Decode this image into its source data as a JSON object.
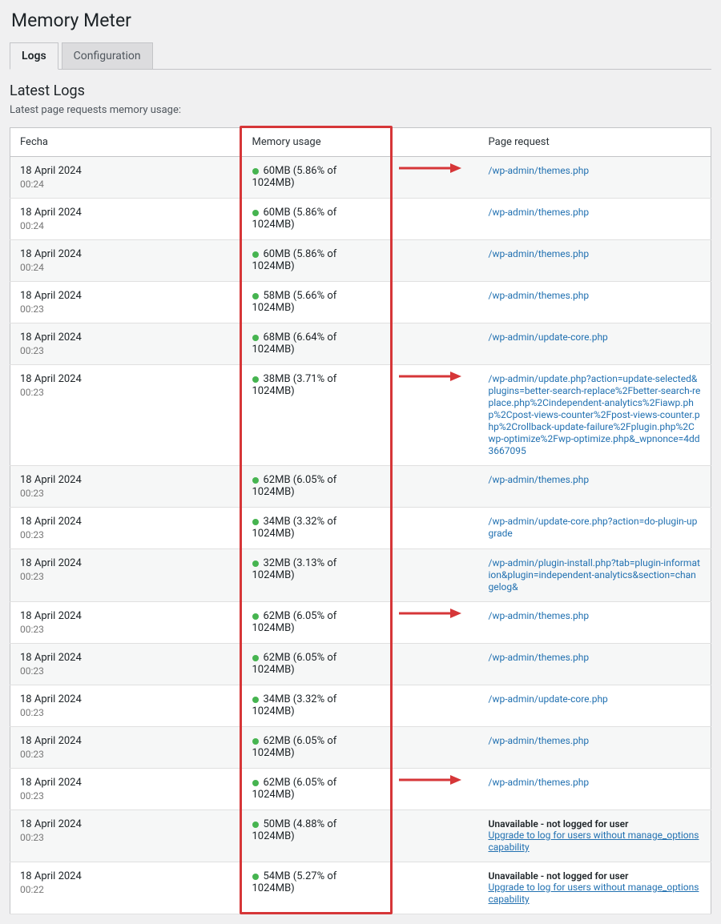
{
  "page_title": "Memory Meter",
  "tabs": {
    "logs": "Logs",
    "config": "Configuration"
  },
  "section": {
    "title": "Latest Logs",
    "subtitle": "Latest page requests memory usage:"
  },
  "headers": {
    "date": "Fecha",
    "memory": "Memory usage",
    "request": "Page request"
  },
  "unavailable": {
    "title": "Unavailable - not logged for user",
    "link": "Upgrade to log for users without manage_options capability"
  },
  "rows": [
    {
      "date": "18 April 2024",
      "time": "00:24",
      "mem": "60MB (5.86% of 1024MB)",
      "req": "/wp-admin/themes.php",
      "arrow": true
    },
    {
      "date": "18 April 2024",
      "time": "00:24",
      "mem": "60MB (5.86% of 1024MB)",
      "req": "/wp-admin/themes.php"
    },
    {
      "date": "18 April 2024",
      "time": "00:24",
      "mem": "60MB (5.86% of 1024MB)",
      "req": "/wp-admin/themes.php"
    },
    {
      "date": "18 April 2024",
      "time": "00:23",
      "mem": "58MB (5.66% of 1024MB)",
      "req": "/wp-admin/themes.php"
    },
    {
      "date": "18 April 2024",
      "time": "00:23",
      "mem": "68MB (6.64% of 1024MB)",
      "req": "/wp-admin/update-core.php"
    },
    {
      "date": "18 April 2024",
      "time": "00:23",
      "mem": "38MB (3.71% of 1024MB)",
      "req": "/wp-admin/update.php?action=update-selected&plugins=better-search-replace%2Fbetter-search-replace.php%2Cindependent-analytics%2Fiawp.php%2Cpost-views-counter%2Fpost-views-counter.php%2Crollback-update-failure%2Fplugin.php%2Cwp-optimize%2Fwp-optimize.php&_wpnonce=4dd3667095",
      "arrow": true
    },
    {
      "date": "18 April 2024",
      "time": "00:23",
      "mem": "62MB (6.05% of 1024MB)",
      "req": "/wp-admin/themes.php"
    },
    {
      "date": "18 April 2024",
      "time": "00:23",
      "mem": "34MB (3.32% of 1024MB)",
      "req": "/wp-admin/update-core.php?action=do-plugin-upgrade"
    },
    {
      "date": "18 April 2024",
      "time": "00:23",
      "mem": "32MB (3.13% of 1024MB)",
      "req": "/wp-admin/plugin-install.php?tab=plugin-information&plugin=independent-analytics&section=changelog&"
    },
    {
      "date": "18 April 2024",
      "time": "00:23",
      "mem": "62MB (6.05% of 1024MB)",
      "req": "/wp-admin/themes.php",
      "arrow": true
    },
    {
      "date": "18 April 2024",
      "time": "00:23",
      "mem": "62MB (6.05% of 1024MB)",
      "req": "/wp-admin/themes.php"
    },
    {
      "date": "18 April 2024",
      "time": "00:23",
      "mem": "34MB (3.32% of 1024MB)",
      "req": "/wp-admin/update-core.php"
    },
    {
      "date": "18 April 2024",
      "time": "00:23",
      "mem": "62MB (6.05% of 1024MB)",
      "req": "/wp-admin/themes.php"
    },
    {
      "date": "18 April 2024",
      "time": "00:23",
      "mem": "62MB (6.05% of 1024MB)",
      "req": "/wp-admin/themes.php",
      "arrow": true
    },
    {
      "date": "18 April 2024",
      "time": "00:23",
      "mem": "50MB (4.88% of 1024MB)",
      "unavailable": true
    },
    {
      "date": "18 April 2024",
      "time": "00:22",
      "mem": "54MB (5.27% of 1024MB)",
      "unavailable": true
    }
  ]
}
